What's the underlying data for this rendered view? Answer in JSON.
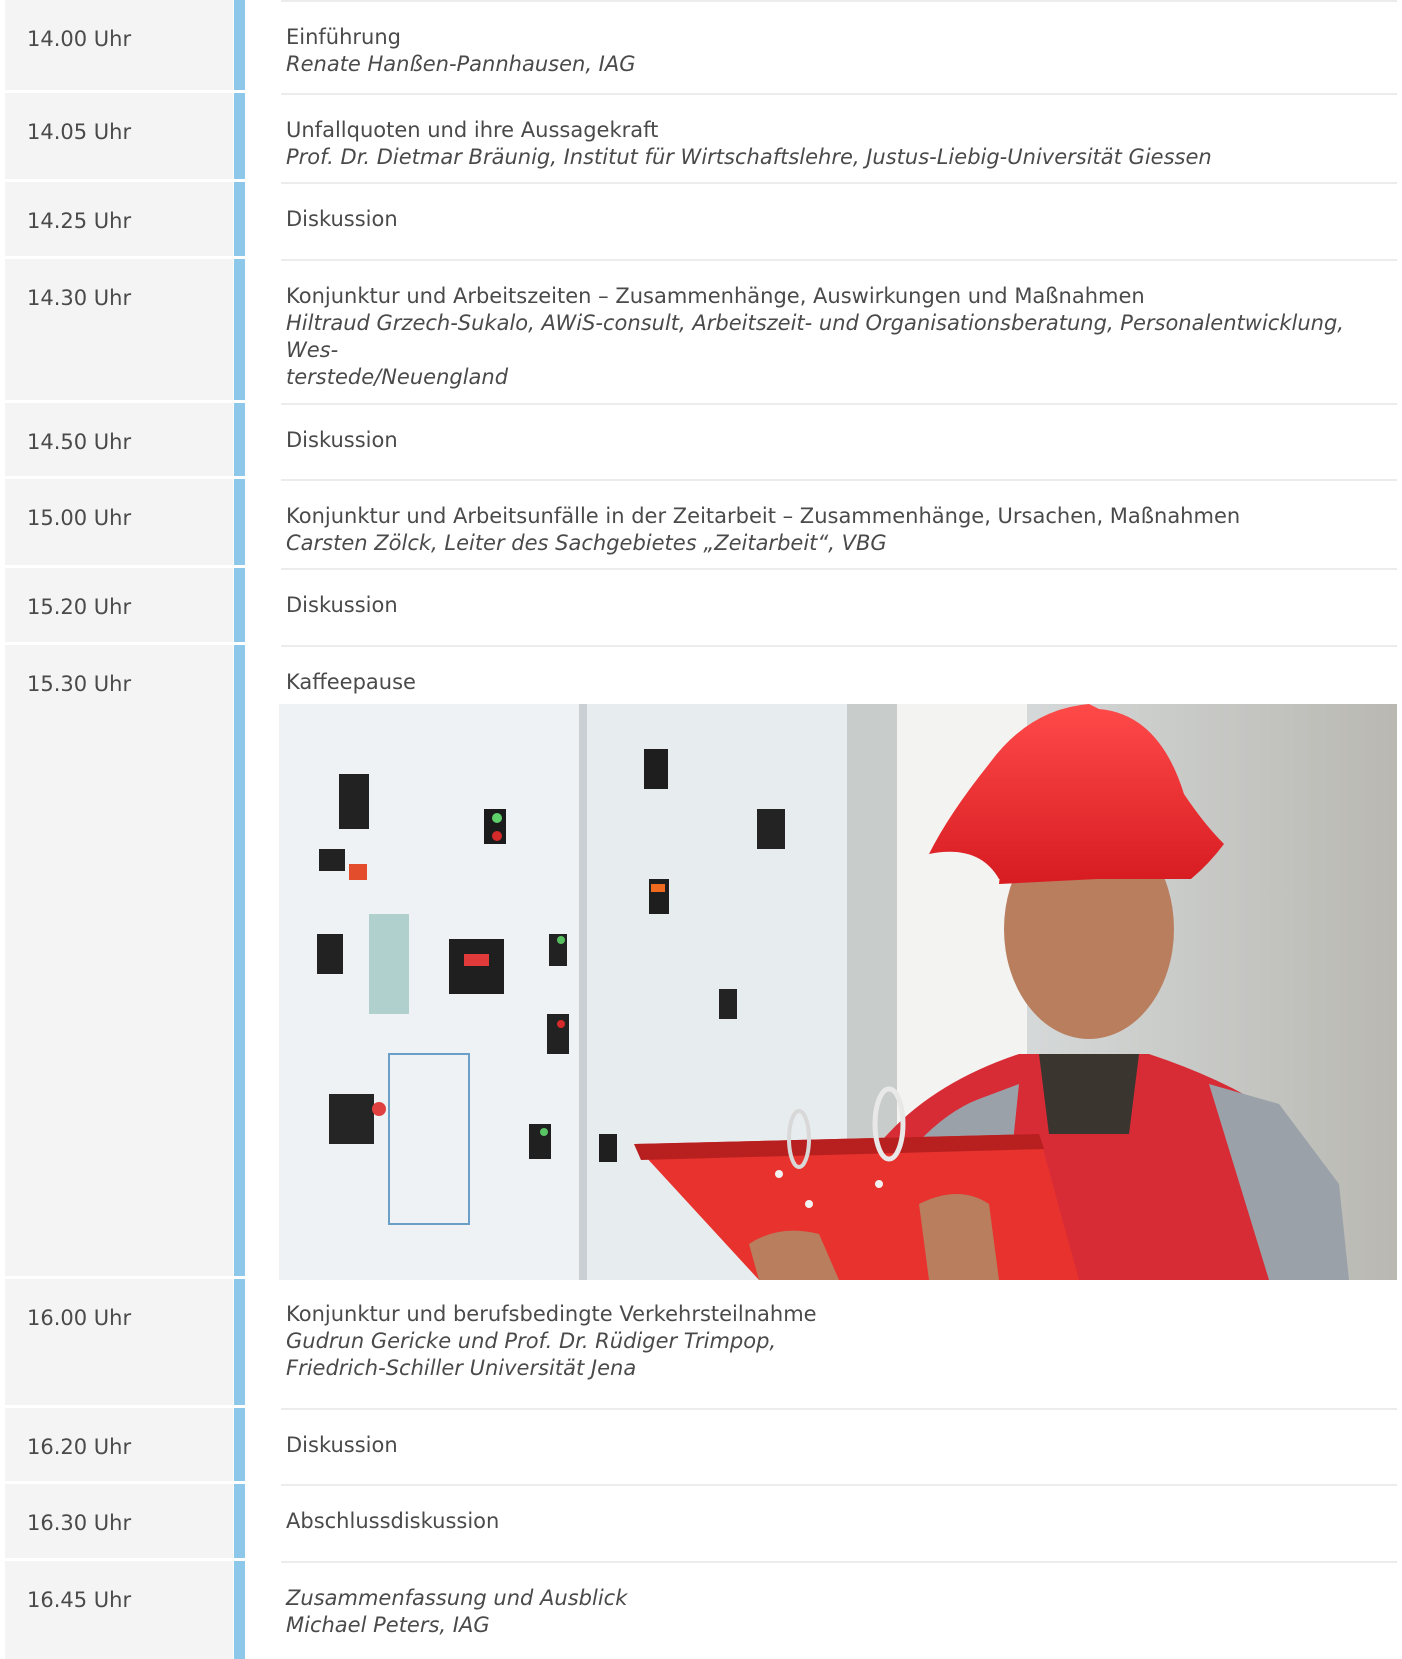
{
  "schedule": [
    {
      "time": "14.00 Uhr",
      "title": "Einführung",
      "title_italic": false,
      "speaker": "Renate Hanßen-Pannhausen, IAG"
    },
    {
      "time": "14.05 Uhr",
      "title": "Unfallquoten und ihre Aussagekraft",
      "title_italic": false,
      "speaker": "Prof. Dr. Dietmar Bräunig, Institut für Wirtschaftslehre, Justus-Liebig-Universität Giessen"
    },
    {
      "time": "14.25 Uhr",
      "title": "Diskussion",
      "title_italic": false,
      "speaker": ""
    },
    {
      "time": "14.30 Uhr",
      "title": "Konjunktur und Arbeitszeiten – Zusammenhänge, Auswirkungen und Maßnahmen",
      "title_italic": false,
      "speaker": "Hiltraud Grzech-Sukalo, AWiS-consult, Arbeitszeit- und Organisationsberatung, Personalentwicklung, Wes-\nterstede/Neuengland"
    },
    {
      "time": "14.50 Uhr",
      "title": "Diskussion",
      "title_italic": false,
      "speaker": ""
    },
    {
      "time": "15.00 Uhr",
      "title": "Konjunktur und Arbeitsunfälle in der Zeitarbeit – Zusammenhänge, Ursachen, Maßnahmen",
      "title_italic": false,
      "speaker": "Carsten Zölck, Leiter des Sachgebietes „Zeitarbeit“, VBG"
    },
    {
      "time": "15.20 Uhr",
      "title": "Diskussion",
      "title_italic": false,
      "speaker": ""
    },
    {
      "time": "15.30 Uhr",
      "title": "Kaffeepause",
      "title_italic": false,
      "speaker": ""
    },
    {
      "time": "16.00 Uhr",
      "title": "Konjunktur und berufsbedingte Verkehrsteilnahme",
      "title_italic": false,
      "speaker": "Gudrun Gericke und Prof. Dr. Rüdiger Trimpop,\nFriedrich-Schiller Universität Jena"
    },
    {
      "time": "16.20 Uhr",
      "title": "Diskussion",
      "title_italic": false,
      "speaker": ""
    },
    {
      "time": "16.30 Uhr",
      "title": "Abschlussdiskussion",
      "title_italic": false,
      "speaker": ""
    },
    {
      "time": "16.45 Uhr",
      "title": "Zusammenfassung und Ausblick",
      "title_italic": true,
      "speaker": "Michael Peters, IAG"
    }
  ],
  "colors": {
    "accent_bar": "#8dc8ea",
    "time_cell_bg": "#f4f4f4",
    "text": "#4a4a4a",
    "divider": "#ececec"
  }
}
